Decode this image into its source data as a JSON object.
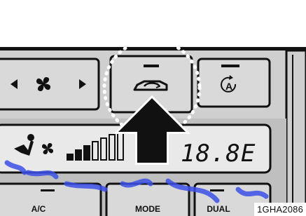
{
  "panel": {
    "bottom_buttons": {
      "ac_label": "A/C",
      "mode_label": "MODE",
      "dual_label": "DUAL"
    },
    "display": {
      "temperature_text": "18.8E"
    }
  },
  "figure_code": "1GHA2086",
  "icons": {
    "fan_speed": "fan-icon",
    "fan_left_arrow": "left-triangle-icon",
    "fan_right_arrow": "right-triangle-icon",
    "recirculation": "car-recirculation-icon",
    "auto_climate": "auto-a-icon",
    "pointer": "up-arrow-icon",
    "highlight": "dotted-circle-highlight"
  },
  "colors": {
    "panel_dark": "#111111",
    "panel_gray": "#cfcfcf",
    "button_fill": "#d9d9d9",
    "display_fill": "#e9e9e9",
    "highlight_ring": "#ffffff",
    "watermark": "#3c50e8"
  }
}
